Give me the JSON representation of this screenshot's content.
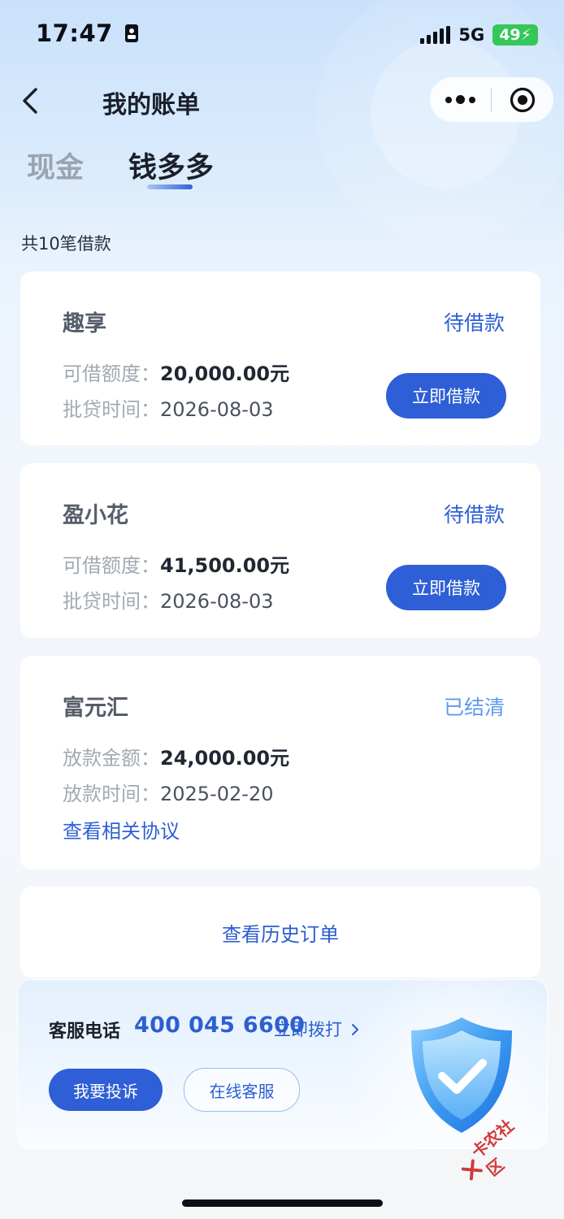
{
  "status_bar": {
    "time": "17:47",
    "network": "5G",
    "battery": "49"
  },
  "nav": {
    "title": "我的账单"
  },
  "tabs": [
    {
      "label": "现金"
    },
    {
      "label": "钱多多"
    }
  ],
  "loan_count": "共10笔借款",
  "loans": [
    {
      "name": "趣享",
      "status": "待借款",
      "status_color": "#2f5fd6",
      "amount_label": "可借额度：",
      "amount": "20,000.00元",
      "date_label": "批贷时间：",
      "date": "2026-08-03",
      "action": "立即借款"
    },
    {
      "name": "盈小花",
      "status": "待借款",
      "status_color": "#2f5fd6",
      "amount_label": "可借额度：",
      "amount": "41,500.00元",
      "date_label": "批贷时间：",
      "date": "2026-08-03",
      "action": "立即借款"
    },
    {
      "name": "富元汇",
      "status": "已结清",
      "status_color": "#5a9bef",
      "amount_label": "放款金额：",
      "amount": "24,000.00元",
      "date_label": "放款时间：",
      "date": "2025-02-20",
      "link": "查看相关协议"
    }
  ],
  "history": "查看历史订单",
  "service": {
    "label": "客服电话",
    "phone": "400 045 6600",
    "call": "立即拨打",
    "complaint": "我要投诉",
    "online": "在线客服"
  },
  "watermark": "卡农社区",
  "colors": {
    "primary": "#2f5fd6",
    "settled": "#5a9bef",
    "battery": "#34c759"
  },
  "icons": [
    "back-arrow-icon",
    "more-dots-icon",
    "target-icon",
    "chevron-right-icon",
    "shield-check-icon",
    "signal-icon",
    "sim-card-icon"
  ]
}
